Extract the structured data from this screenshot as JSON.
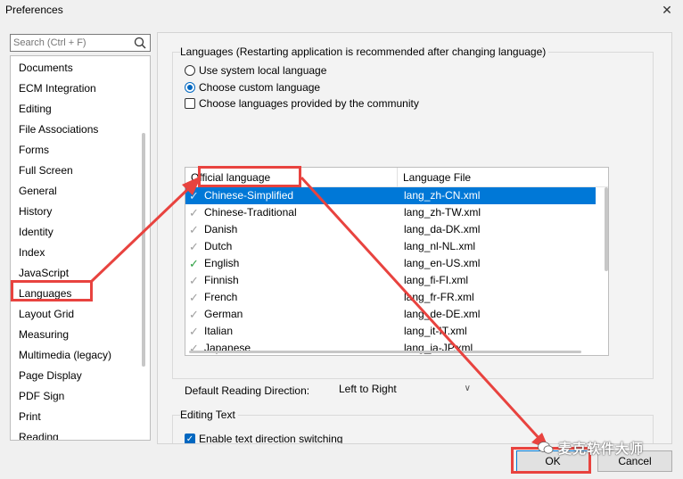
{
  "window": {
    "title": "Preferences",
    "close_glyph": "✕"
  },
  "search": {
    "placeholder": "Search (Ctrl + F)"
  },
  "sidebar": {
    "items": [
      "Documents",
      "ECM Integration",
      "Editing",
      "File Associations",
      "Forms",
      "Full Screen",
      "General",
      "History",
      "Identity",
      "Index",
      "JavaScript",
      "Languages",
      "Layout Grid",
      "Measuring",
      "Multimedia (legacy)",
      "Page Display",
      "PDF Sign",
      "Print",
      "Reading"
    ],
    "selected": "Languages"
  },
  "languages": {
    "group_title": "Languages (Restarting application is recommended after changing language)",
    "option_system": "Use system local language",
    "option_custom": "Choose custom language",
    "option_community": "Choose languages provided by the community",
    "selected_option": "custom",
    "community_checked": false,
    "table": {
      "columns": [
        "Official language",
        "Language File"
      ],
      "rows": [
        {
          "language": "Chinese-Simplified",
          "file": "lang_zh-CN.xml",
          "selected": true,
          "active": false
        },
        {
          "language": "Chinese-Traditional",
          "file": "lang_zh-TW.xml",
          "selected": false,
          "active": false
        },
        {
          "language": "Danish",
          "file": "lang_da-DK.xml",
          "selected": false,
          "active": false
        },
        {
          "language": "Dutch",
          "file": "lang_nl-NL.xml",
          "selected": false,
          "active": false
        },
        {
          "language": "English",
          "file": "lang_en-US.xml",
          "selected": false,
          "active": true
        },
        {
          "language": "Finnish",
          "file": "lang_fi-FI.xml",
          "selected": false,
          "active": false
        },
        {
          "language": "French",
          "file": "lang_fr-FR.xml",
          "selected": false,
          "active": false
        },
        {
          "language": "German",
          "file": "lang_de-DE.xml",
          "selected": false,
          "active": false
        },
        {
          "language": "Italian",
          "file": "lang_it-IT.xml",
          "selected": false,
          "active": false
        },
        {
          "language": "Japanese",
          "file": "lang_ja-JP.xml",
          "selected": false,
          "active": false
        }
      ]
    },
    "reading_direction_label": "Default Reading Direction:",
    "reading_direction_value": "Left to Right"
  },
  "editing_text": {
    "group_title": "Editing Text",
    "option_direction": "Enable text direction switching",
    "direction_checked": true
  },
  "buttons": {
    "ok": "OK",
    "cancel": "Cancel"
  },
  "watermark": {
    "text": "麦克软件大师"
  },
  "colors": {
    "accent": "#0078d7",
    "annotation": "#e8433f",
    "active_check": "#2ea043"
  },
  "icons": [
    "search-icon",
    "close-icon",
    "check-icon",
    "chevron-down-icon",
    "radio-selected-icon",
    "checkbox-checked-icon"
  ]
}
